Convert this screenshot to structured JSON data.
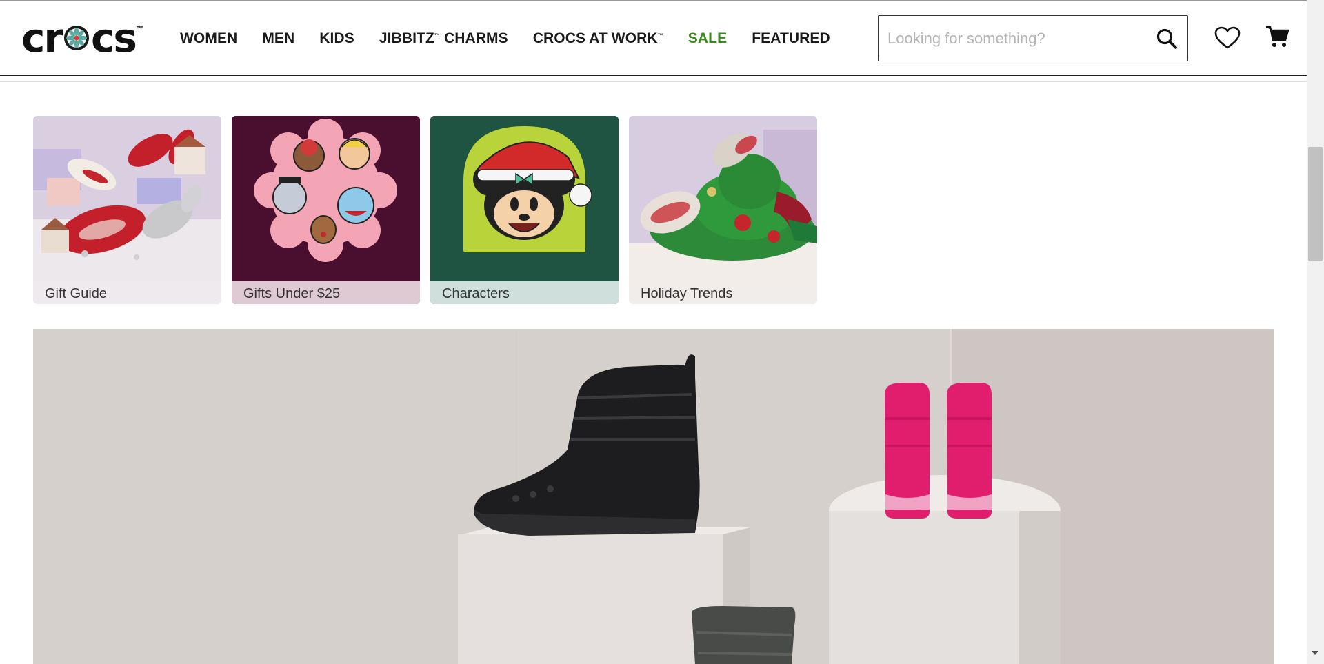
{
  "brand": {
    "name": "crocs",
    "logo_left": "cr",
    "logo_right": "cs",
    "trademark": "™"
  },
  "nav": {
    "items": [
      {
        "label": "WOMEN"
      },
      {
        "label": "MEN"
      },
      {
        "label": "KIDS"
      },
      {
        "label": "JIBBITZ",
        "sup": "™",
        "suffix": " CHARMS"
      },
      {
        "label": "CROCS AT WORK",
        "sup": "™"
      },
      {
        "label": "SALE"
      },
      {
        "label": "FEATURED"
      }
    ]
  },
  "search": {
    "placeholder": "Looking for something?",
    "icon": "search-icon"
  },
  "header_icons": {
    "wishlist": "heart-icon",
    "cart": "cart-icon"
  },
  "colors": {
    "sale": "#3b8a1e",
    "tile2_bg": "#4a0e2e",
    "tile3_bg": "#1f5443",
    "hero_bg": "#d8d2cf"
  },
  "tiles": [
    {
      "caption": "Gift Guide"
    },
    {
      "caption": "Gifts Under $25"
    },
    {
      "caption": "Characters"
    },
    {
      "caption": "Holiday Trends"
    }
  ]
}
